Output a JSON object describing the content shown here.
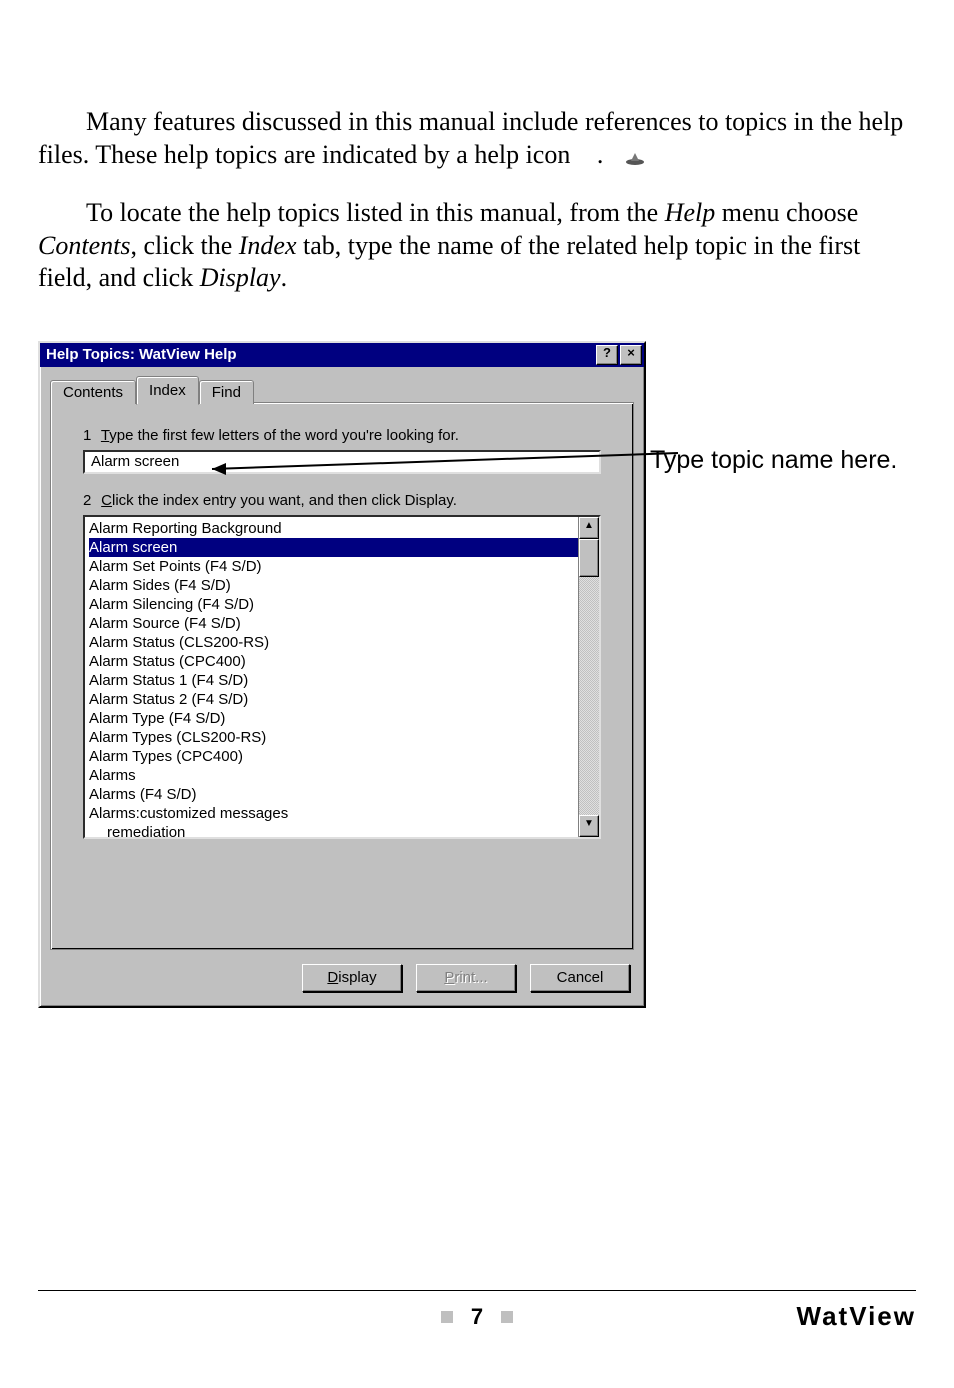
{
  "paragraphs": {
    "p1_a": "Many features discussed in this manual include references to topics in the help files. These help topics are indicated by a help icon ",
    "p1_b": ".",
    "p2_a": "To locate the help topics listed in this manual, from the ",
    "p2_help": "Help",
    "p2_b": " menu choose ",
    "p2_contents": "Contents",
    "p2_c": ", click the ",
    "p2_index": "Index",
    "p2_d": " tab, type the name of the related help topic in the first field, and click ",
    "p2_display": "Display",
    "p2_e": "."
  },
  "callout": "Type topic name here.",
  "dialog": {
    "title": "Help Topics: WatView Help",
    "help_btn": "?",
    "close_btn": "×",
    "tabs": {
      "contents": "Contents",
      "index": "Index",
      "find": "Find"
    },
    "instr1_num": "1",
    "instr1_pre": "T",
    "instr1_rest": "ype the first few letters of the word you're looking for.",
    "search_value": "Alarm screen",
    "instr2_num": "2",
    "instr2_pre": "C",
    "instr2_rest": "lick the index entry you want, and then click Display.",
    "items": [
      "Alarm Reporting Background",
      "Alarm screen",
      "Alarm Set Points (F4 S/D)",
      "Alarm Sides (F4 S/D)",
      "Alarm Silencing (F4 S/D)",
      "Alarm Source (F4 S/D)",
      "Alarm Status (CLS200-RS)",
      "Alarm Status (CPC400)",
      "Alarm Status 1 (F4 S/D)",
      "Alarm Status 2 (F4 S/D)",
      "Alarm Type (F4 S/D)",
      "Alarm Types (CLS200-RS)",
      "Alarm Types (CPC400)",
      "Alarms",
      "Alarms (F4 S/D)",
      "Alarms:customized messages",
      "remediation"
    ],
    "selected_index": 1,
    "indented_index": 16,
    "scroll_up": "▲",
    "scroll_down": "▼",
    "buttons": {
      "display_u": "D",
      "display_rest": "isplay",
      "print_u": "P",
      "print_rest": "rint...",
      "cancel": "Cancel"
    }
  },
  "footer": {
    "page": "7",
    "brand": "WatView"
  }
}
